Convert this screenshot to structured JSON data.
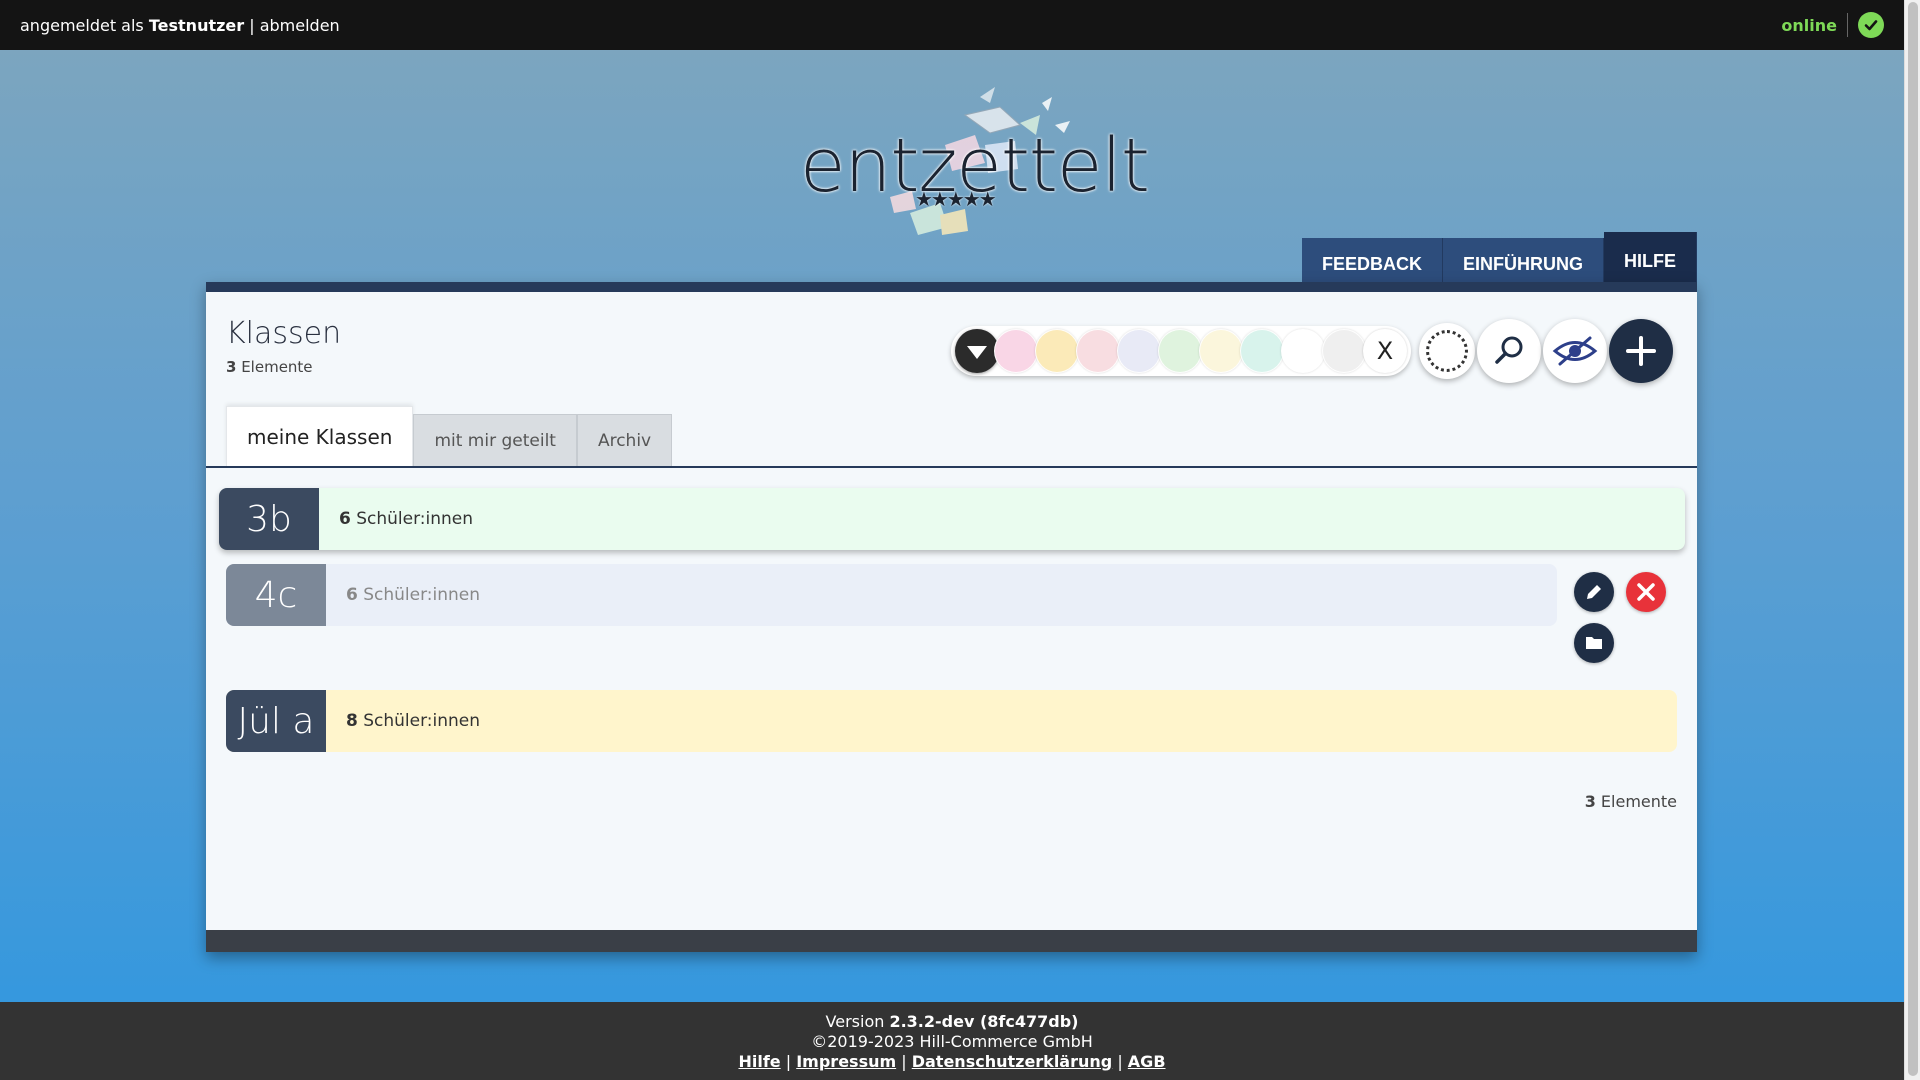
{
  "topbar": {
    "login_prefix": "angemeldet als ",
    "username": "Testnutzer",
    "separator": " | ",
    "logout": "abmelden",
    "status": "online",
    "status_color": "#7ed957"
  },
  "logo": {
    "wordmark": "entzettelt",
    "stars": "★★★★★"
  },
  "nav": {
    "tabs": [
      {
        "label": "FEEDBACK"
      },
      {
        "label": "EINFÜHRUNG"
      },
      {
        "label": "HILFE",
        "active": true
      }
    ]
  },
  "panel": {
    "title": "Klassen",
    "count": "3",
    "count_label": " Elemente"
  },
  "toolbar": {
    "dropdown_icon": "triangle-down-icon",
    "swatches": [
      "#f9d6e6",
      "#fbeab8",
      "#f8dde1",
      "#e8eaf6",
      "#dff3de",
      "#fbf6dc",
      "#d8f3ec",
      "#ffffff",
      "#efefef"
    ],
    "clear_label": "X",
    "buttons": [
      "select-all-circle-icon",
      "search-icon",
      "eye-off-icon",
      "plus-icon"
    ]
  },
  "subtabs": [
    {
      "label": "meine Klassen",
      "active": true
    },
    {
      "label": "mit mir geteilt"
    },
    {
      "label": "Archiv"
    }
  ],
  "classes": [
    {
      "name": "3b",
      "count": "6",
      "count_label": " Schüler:innen",
      "color": "#eafcef"
    },
    {
      "name": "4c",
      "count": "6",
      "count_label": " Schüler:innen",
      "color": "#eaeff8"
    },
    {
      "name": "Jül a",
      "count": "8",
      "count_label": " Schüler:innen",
      "color": "#fff5cc"
    }
  ],
  "row_actions": [
    "edit-icon",
    "delete-icon",
    "folder-icon"
  ],
  "list_footer": {
    "count": "3",
    "label": " Elemente"
  },
  "footer": {
    "version_prefix": "Version ",
    "version": "2.3.2-dev (8fc477db)",
    "copyright": "©2019-2023 Hill-Commerce GmbH",
    "links": [
      "Hilfe",
      "Impressum",
      "Datenschutzerklärung",
      "AGB"
    ],
    "link_sep": " | "
  }
}
